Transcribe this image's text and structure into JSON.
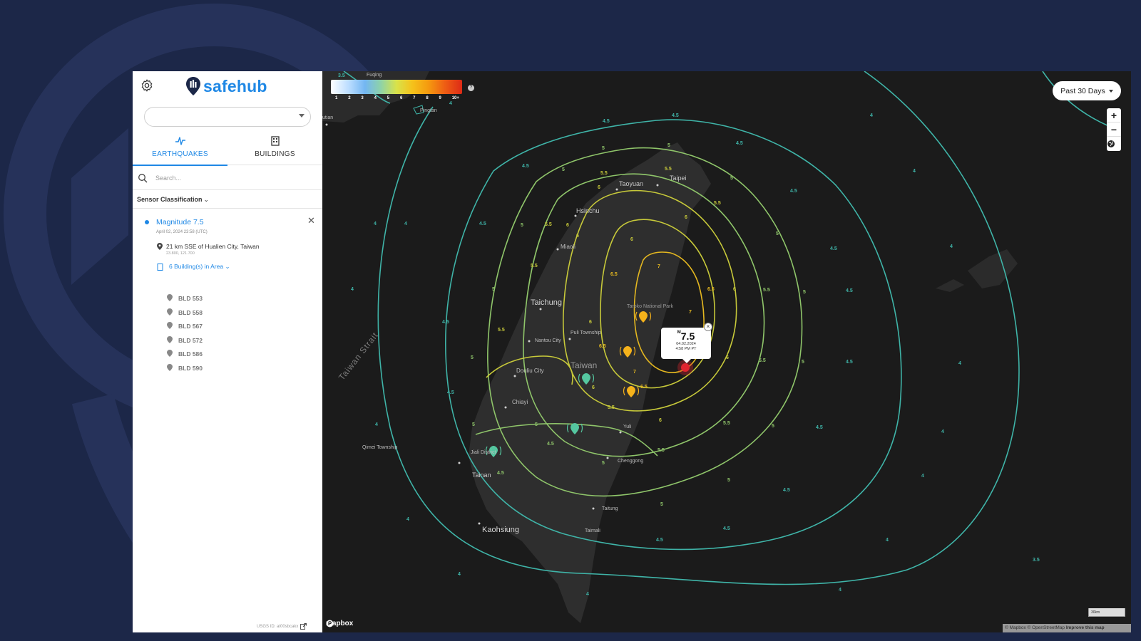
{
  "sidebar": {
    "brand": "safehub",
    "org_select": {
      "value": ""
    },
    "tabs": [
      {
        "label": "EARTHQUAKES",
        "active": true,
        "icon": "pulse-icon"
      },
      {
        "label": "BUILDINGS",
        "active": false,
        "icon": "building-icon"
      }
    ],
    "search": {
      "placeholder": "Search..."
    },
    "filter": {
      "label": "Sensor Classification"
    },
    "event": {
      "title": "Magnitude 7.5",
      "date": "April 02, 2024 23:58 (UTC)",
      "location": "21 km SSE of Hualien City, Taiwan",
      "coords": "23.800, 121.700",
      "buildings_toggle": "6 Building(s) in Area",
      "buildings": [
        "BLD 553",
        "BLD 558",
        "BLD 567",
        "BLD 572",
        "BLD 586",
        "BLD 590"
      ],
      "usgs_id": "USGS ID: at00sbcakx"
    }
  },
  "map": {
    "legend": {
      "ticks": [
        "1",
        "2",
        "3",
        "4",
        "5",
        "6",
        "7",
        "8",
        "9",
        "10+"
      ],
      "help": "?"
    },
    "range_button": "Past 30 Days",
    "zoom": {
      "in": "+",
      "out": "−"
    },
    "popup": {
      "mag_prefix": "M",
      "magnitude": "7.5",
      "date": "04.02.2024",
      "time": "4:58 PM PT"
    },
    "labels": {
      "taipei": "Taipei",
      "taoyuan": "Taoyuan",
      "hsinchu": "Hsinchu",
      "miaoli": "Miaoli",
      "taichung": "Taichung",
      "puli": "Puli Township",
      "nantou": "Nantou City",
      "taiwan": "Taiwan",
      "douliu": "Douliu City",
      "chiayi": "Chiayi",
      "tainan": "Tainan",
      "kaohsiung": "Kaohsiung",
      "yuli": "Yuli",
      "chenggong": "Chenggong",
      "taitung": "Taitung",
      "taimali": "Taimali",
      "taroko": "Taroko National Park",
      "qimei": "Qimei Township",
      "jiali": "Jiali District",
      "pingtan": "Pingtan",
      "fuqing": "Fuqing",
      "putian": "utian",
      "strait": "Taiwan Strait"
    },
    "mapbox": "mapbox",
    "scale": "30km",
    "attribution": "© Mapbox © OpenStreetMap",
    "attribution_link": "Improve this map",
    "contour_labels": [
      "3.5",
      "4",
      "4.5",
      "5",
      "5.5",
      "6",
      "6.5",
      "7"
    ]
  },
  "colors": {
    "brand_blue": "#1f88e5",
    "page_bg": "#1c2748",
    "map_bg": "#1b1b1b",
    "land": "#2c2c2c",
    "contour_4": "#3fb4a8",
    "contour_5": "#8fc56a",
    "contour_6": "#c7c93a",
    "contour_7": "#e5b820",
    "sensor_orange": "#f5b21b",
    "sensor_green": "#55c7a0",
    "epicenter": "#e0242f"
  }
}
